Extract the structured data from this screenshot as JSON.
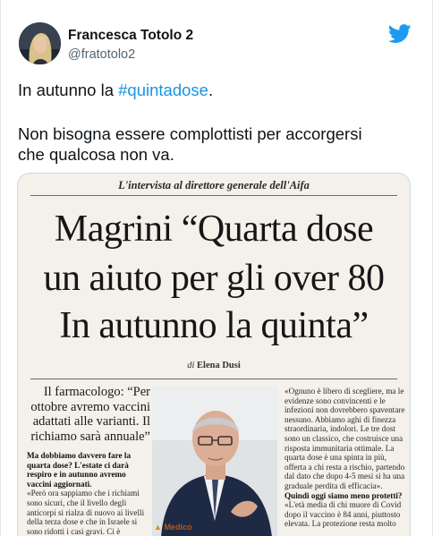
{
  "author": {
    "name": "Francesca Totolo 2",
    "handle": "@fratotolo2"
  },
  "icons": {
    "brand": "twitter-bird-icon",
    "avatar": "profile-photo"
  },
  "colors": {
    "hashtag": "#1b95e0",
    "twitter_blue": "#1d9bf0"
  },
  "tweet": {
    "line1_prefix": "In autunno la ",
    "hashtag": "#quintadose",
    "line1_suffix": ".",
    "line2": "Non bisogna essere complottisti per accorgersi",
    "line3": "che qualcosa non va."
  },
  "newspaper": {
    "kicker": "L'intervista al direttore generale dell'Aifa",
    "headline_1": "Magrini “Quarta dose",
    "headline_2": "un aiuto per gli over 80",
    "headline_3": "In autunno la quinta”",
    "byline_prefix": "di",
    "byline_author": "Elena Dusi",
    "sub_1": "Il farmacologo: “Per",
    "sub_2": "ottobre avremo vaccini",
    "sub_3": "adattati alle varianti. Il",
    "sub_4": "richiamo sarà annuale”",
    "left_col_q": "Ma dobbiamo davvero fare la quarta dose? L'estate ci darà respiro e in autunno avremo vaccini aggiornati.",
    "left_col_a": "«Però ora sappiamo che i richiami sono sicuri, che il livello degli anticorpi si rialza di nuovo ai livelli della terza dose e che in Israele si sono ridotti i casi gravi. Ci è sembrato giusto raccomandarla a tutti sopra",
    "right_col_a1": "«Ognuno è libero di scegliere, ma le evidenze sono convincenti e le infezioni non dovrebbero spaventare nessuno. Abbiamo aghi di finezza straordinaria, indolori. Le tre dost sono un classico, che costruisce una risposta immunitaria ottimale. La quarta dose è una spinta in più, offerta a chi resta a rischio, partendo dal dato che dopo 4-5 mesi si ha una graduale perdita di efficacia».",
    "right_col_q": "Quindi oggi siamo meno protetti?",
    "right_col_a2": "«L'età media di chi muore di Covid dopo il vaccino è 84 anni, piuttosto elevata. La protezione resta molto",
    "caption_marker": "▲",
    "caption": "Medico"
  }
}
